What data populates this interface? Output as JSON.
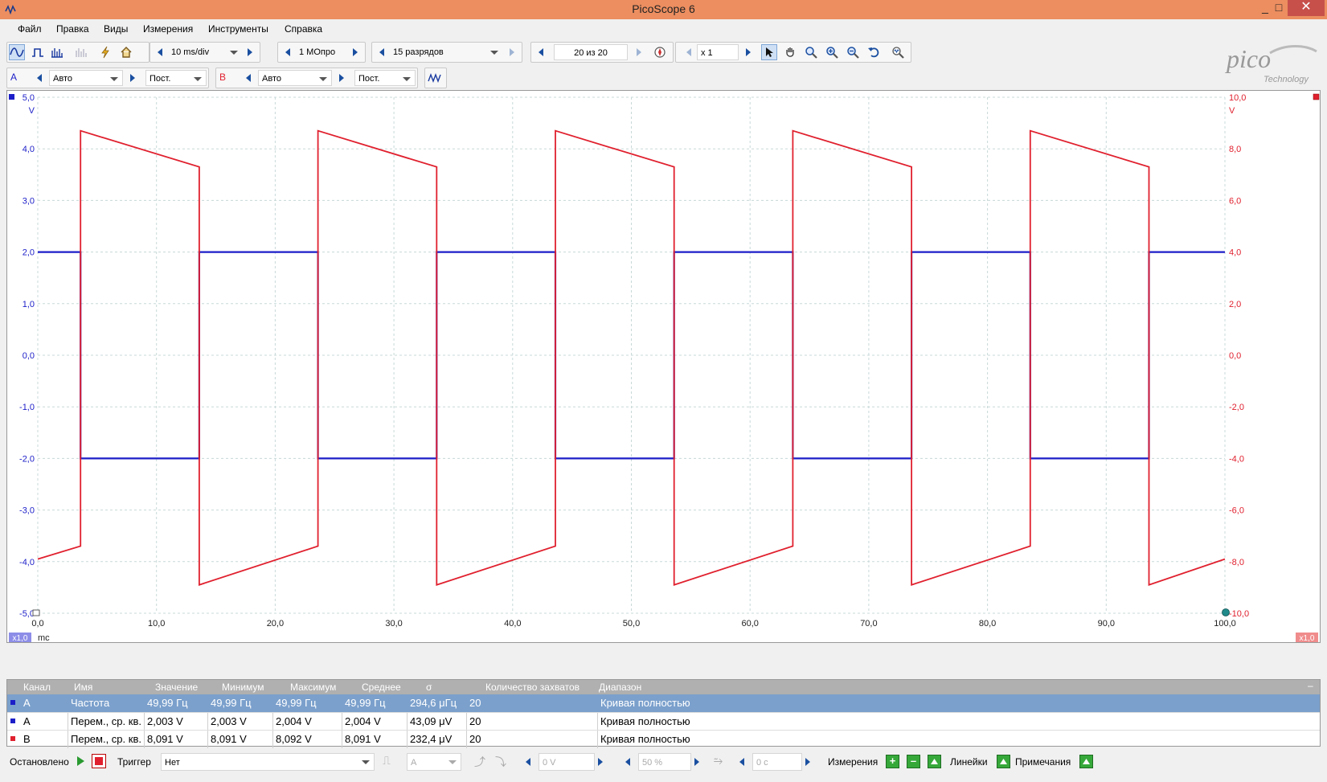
{
  "window": {
    "title": "PicoScope 6",
    "minimize": "_",
    "maximize": "□",
    "close": "✕"
  },
  "menu": [
    "Файл",
    "Правка",
    "Виды",
    "Измерения",
    "Инструменты",
    "Справка"
  ],
  "toolbar1": {
    "timebase": "10 ms/div",
    "samples": "1 МОпро",
    "resolution": "15 разрядов",
    "buffer": "20 из 20",
    "zoom": "x 1"
  },
  "toolbar2": {
    "chA_label": "A",
    "chA_range": "Авто",
    "chA_coupling": "Пост.",
    "chB_label": "B",
    "chB_range": "Авто",
    "chB_coupling": "Пост."
  },
  "logo": {
    "name": "pico",
    "sub": "Technology"
  },
  "colors": {
    "chA": "#1c1ec8",
    "chB": "#e0202e",
    "grid": "#c8d8d8",
    "titlebar": "#ec8e60",
    "selected_row": "#7ba0cc"
  },
  "chart_data": {
    "type": "line",
    "xlabel": "mc",
    "xlim": [
      0,
      100
    ],
    "x_ticks": [
      "0,0",
      "10,0",
      "20,0",
      "30,0",
      "40,0",
      "50,0",
      "60,0",
      "70,0",
      "80,0",
      "90,0",
      "100,0"
    ],
    "left_axis": {
      "unit": "V",
      "ylim": [
        -5,
        5
      ],
      "ticks": [
        "5,0",
        "4,0",
        "3,0",
        "2,0",
        "1,0",
        "0,0",
        "-1,0",
        "-2,0",
        "-3,0",
        "-4,0",
        "-5,0"
      ]
    },
    "right_axis": {
      "unit": "V",
      "ylim": [
        -10,
        10
      ],
      "ticks": [
        "10,0",
        "8,0",
        "6,0",
        "4,0",
        "2,0",
        "0,0",
        "-2,0",
        "-4,0",
        "-6,0",
        "-8,0",
        "-10,0"
      ]
    },
    "x_scale_label": "x1,0",
    "right_scale_label": "x1,0",
    "grid": true,
    "series": [
      {
        "name": "A",
        "axis": "left",
        "x": [
          0,
          3.6,
          3.6,
          13.6,
          13.6,
          23.6,
          23.6,
          33.6,
          33.6,
          43.6,
          43.6,
          53.6,
          53.6,
          63.6,
          63.6,
          73.6,
          73.6,
          83.6,
          83.6,
          93.6,
          93.6,
          100
        ],
        "y": [
          2,
          2,
          -2,
          -2,
          2,
          2,
          -2,
          -2,
          2,
          2,
          -2,
          -2,
          2,
          2,
          -2,
          -2,
          2,
          2,
          -2,
          -2,
          2,
          2
        ]
      },
      {
        "name": "B",
        "axis": "right",
        "x": [
          0,
          3.6,
          3.6,
          13.6,
          13.6,
          23.6,
          23.6,
          33.6,
          33.6,
          43.6,
          43.6,
          53.6,
          53.6,
          63.6,
          63.6,
          73.6,
          73.6,
          83.6,
          83.6,
          93.6,
          93.6,
          100
        ],
        "y": [
          -7.9,
          -7.4,
          8.7,
          7.3,
          -8.9,
          -7.4,
          8.7,
          7.3,
          -8.9,
          -7.4,
          8.7,
          7.3,
          -8.9,
          -7.4,
          8.7,
          7.3,
          -8.9,
          -7.4,
          8.7,
          7.3,
          -8.9,
          -7.9
        ]
      }
    ]
  },
  "measurements": {
    "headers": [
      "Канал",
      "Имя",
      "Значение",
      "Минимум",
      "Максимум",
      "Среднее",
      "σ",
      "Количество захватов",
      "Диапазон"
    ],
    "rows": [
      {
        "channel": "A",
        "name": "Частота",
        "value": "49,99 Гц",
        "min": "49,99 Гц",
        "max": "49,99 Гц",
        "avg": "49,99 Гц",
        "sigma": "294,6 μГц",
        "count": "20",
        "range": "Кривая полностью",
        "selected": true
      },
      {
        "channel": "A",
        "name": "Перем., ср. кв.",
        "value": "2,003 V",
        "min": "2,003 V",
        "max": "2,004 V",
        "avg": "2,004 V",
        "sigma": "43,09 μV",
        "count": "20",
        "range": "Кривая полностью",
        "selected": false
      },
      {
        "channel": "B",
        "name": "Перем., ср. кв.",
        "value": "8,091 V",
        "min": "8,091 V",
        "max": "8,092 V",
        "avg": "8,091 V",
        "sigma": "232,4 μV",
        "count": "20",
        "range": "Кривая полностью",
        "selected": false
      }
    ]
  },
  "status": {
    "state": "Остановлено",
    "trigger_label": "Триггер",
    "trigger_mode": "Нет",
    "trigger_channel": "A",
    "trigger_level": "0 V",
    "trigger_percent": "50 %",
    "trigger_delay": "0 с",
    "measurements_label": "Измерения",
    "rulers_label": "Линейки",
    "notes_label": "Примечания"
  }
}
